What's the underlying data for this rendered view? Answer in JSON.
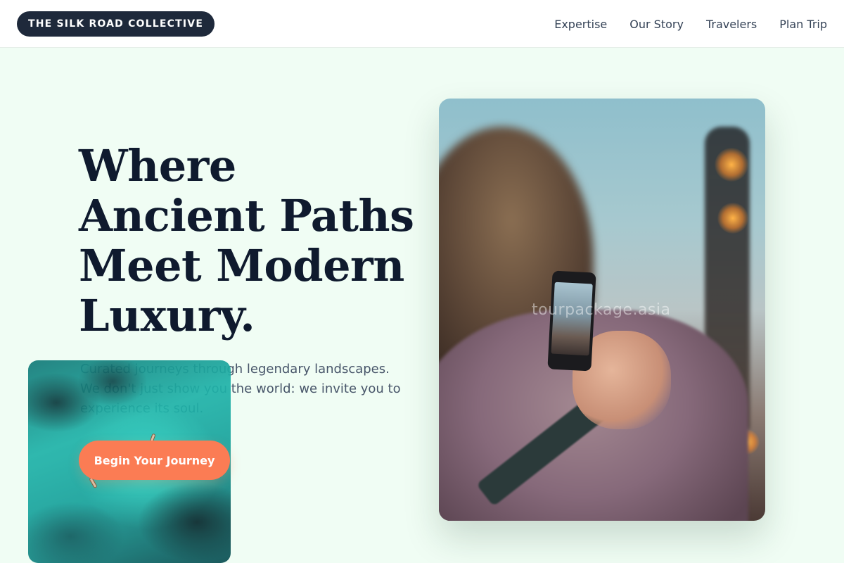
{
  "header": {
    "brand": "THE SILK ROAD COLLECTIVE",
    "nav": [
      {
        "label": "Expertise"
      },
      {
        "label": "Our Story"
      },
      {
        "label": "Travelers"
      },
      {
        "label": "Plan Trip"
      }
    ]
  },
  "hero": {
    "headline_lines": [
      "Where",
      "Ancient Paths",
      "Meet Modern",
      "Luxury."
    ],
    "subtext": "Curated journeys through legendary landscapes. We don't just show you the world: we invite you to experience its soul.",
    "cta_label": "Begin Your Journey"
  },
  "photo": {
    "watermark": "tourpackage.asia"
  },
  "colors": {
    "background": "#f0fdf4",
    "brand_badge": "#1e293b",
    "cta": "#fb7c54",
    "headline": "#0f1a2e",
    "body_text": "#475569"
  }
}
